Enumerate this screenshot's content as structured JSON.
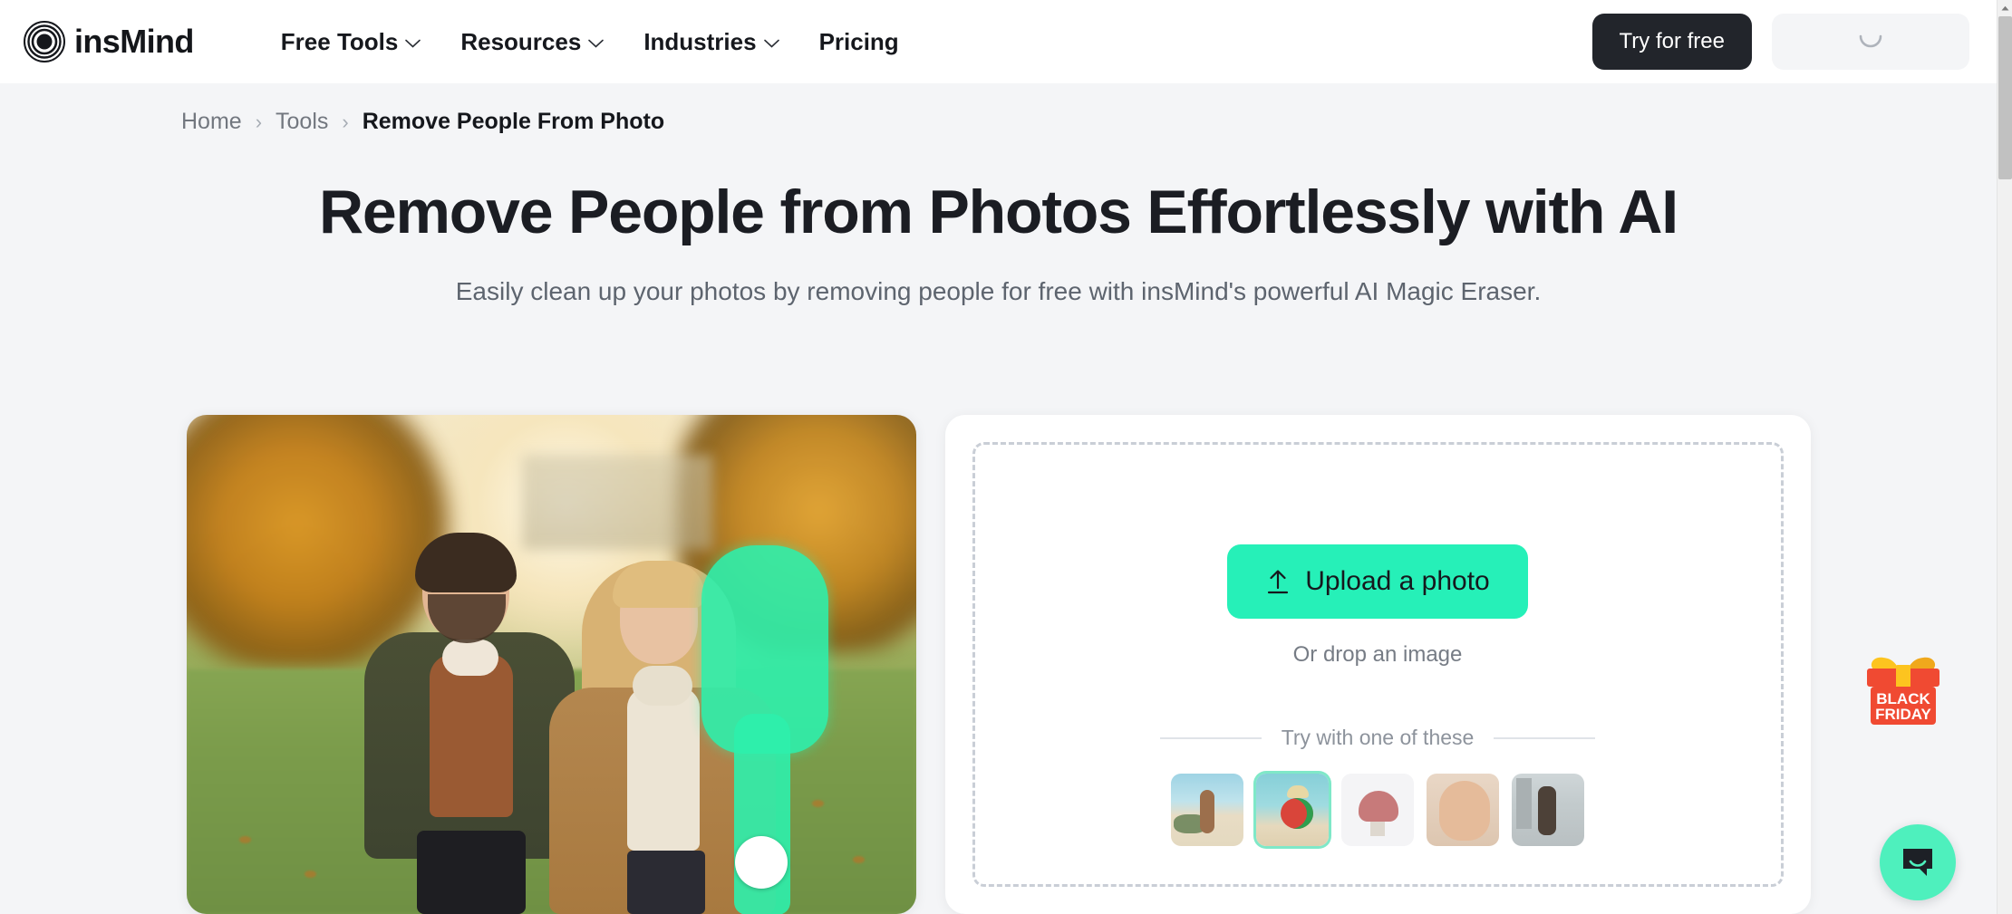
{
  "header": {
    "logo": {
      "text": "insMind",
      "icon": "concentric-rings-logo"
    },
    "nav": [
      {
        "label": "Free Tools",
        "has_dropdown": true
      },
      {
        "label": "Resources",
        "has_dropdown": true
      },
      {
        "label": "Industries",
        "has_dropdown": true
      },
      {
        "label": "Pricing",
        "has_dropdown": false
      }
    ],
    "try_free_label": "Try for free",
    "user_pill_icon": "loading-spinner-arc"
  },
  "breadcrumb": {
    "items": [
      {
        "label": "Home",
        "current": false
      },
      {
        "label": "Tools",
        "current": false
      },
      {
        "label": "Remove People From Photo",
        "current": true
      }
    ],
    "separator": "›"
  },
  "hero": {
    "title": "Remove People from Photos Effortlessly with AI",
    "subtitle": "Easily clean up your photos by removing people for free with insMind's powerful AI Magic Eraser."
  },
  "preview": {
    "alt": "couple-in-autumn-park-with-green-removal-mask",
    "mask_color": "#2EF0AC",
    "brush_cursor": "white-circle-brush"
  },
  "upload": {
    "button_label": "Upload a photo",
    "button_icon": "upload-arrow-icon",
    "drop_hint": "Or drop an image",
    "samples_label": "Try with one of these",
    "thumbnails": [
      {
        "name": "woman-on-beach",
        "selected": false
      },
      {
        "name": "child-with-swim-ring",
        "selected": true
      },
      {
        "name": "pink-bucket-hat",
        "selected": false
      },
      {
        "name": "woman-applying-cream",
        "selected": false
      },
      {
        "name": "woman-on-city-street",
        "selected": false
      }
    ]
  },
  "widgets": {
    "black_friday": {
      "line1": "BLACK",
      "line2": "FRIDAY",
      "icon": "gift-box-icon"
    },
    "chat": {
      "icon": "chat-bubble-smile-icon"
    }
  },
  "colors": {
    "accent_green": "#26F0B8",
    "chat_green": "#4EF0BD",
    "dark": "#22252B",
    "page_bg": "#F4F5F7",
    "badge_red": "#F04A32",
    "badge_yellow": "#FDC41F"
  }
}
